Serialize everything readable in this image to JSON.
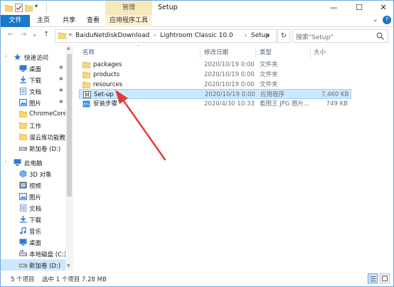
{
  "window": {
    "title": "Setup",
    "contextual_tab_group": "管理",
    "controls": {
      "minimize": "—",
      "maximize": "☐",
      "close": "✕"
    }
  },
  "ribbon": {
    "tabs": [
      "文件",
      "主页",
      "共享",
      "查看",
      "应用程序工具"
    ],
    "collapse": "⌄",
    "help": "?"
  },
  "address": {
    "prefix": "«",
    "crumbs": [
      "BaiduNetdiskDownload",
      "Lightroom Classic 10.0",
      "Setup"
    ],
    "separator": "›",
    "refresh": "↻",
    "search_placeholder": "搜索\"Setup\""
  },
  "navigation": {
    "quick_access": "快速访问",
    "items": [
      {
        "label": "桌面",
        "icon": "desktop-icon",
        "pinned": true
      },
      {
        "label": "下载",
        "icon": "download-icon",
        "pinned": true
      },
      {
        "label": "文档",
        "icon": "document-icon",
        "pinned": true
      },
      {
        "label": "图片",
        "icon": "picture-icon",
        "pinned": true
      },
      {
        "label": "ChromeCoreD",
        "icon": "folder-icon",
        "pinned": false
      },
      {
        "label": "工作",
        "icon": "folder-icon",
        "pinned": false
      },
      {
        "label": "溜云库功能教程",
        "icon": "folder-icon",
        "pinned": false
      },
      {
        "label": "新加卷 (D:)",
        "icon": "drive-icon",
        "pinned": false
      }
    ],
    "this_pc": "此电脑",
    "pc_items": [
      {
        "label": "3D 对象",
        "icon": "cube-icon"
      },
      {
        "label": "视频",
        "icon": "video-icon"
      },
      {
        "label": "图片",
        "icon": "picture-icon"
      },
      {
        "label": "文档",
        "icon": "document-icon"
      },
      {
        "label": "下载",
        "icon": "download-icon"
      },
      {
        "label": "音乐",
        "icon": "music-icon"
      },
      {
        "label": "桌面",
        "icon": "desktop-icon"
      },
      {
        "label": "本地磁盘 (C:)",
        "icon": "drive-icon"
      },
      {
        "label": "新加卷 (D:)",
        "icon": "drive-icon"
      }
    ],
    "pin_glyph": "✱",
    "expand_glyph": "›"
  },
  "file_list": {
    "columns": {
      "name": "名称",
      "date": "修改日期",
      "type": "类型",
      "size": "大小"
    },
    "sort_glyph": "⌃",
    "rows": [
      {
        "name": "packages",
        "date": "2020/10/19 0:00",
        "type": "文件夹",
        "size": "",
        "icon": "folder-icon",
        "selected": false
      },
      {
        "name": "products",
        "date": "2020/10/19 0:00",
        "type": "文件夹",
        "size": "",
        "icon": "folder-icon",
        "selected": false
      },
      {
        "name": "resources",
        "date": "2020/10/19 0:00",
        "type": "文件夹",
        "size": "",
        "icon": "folder-icon",
        "selected": false
      },
      {
        "name": "Set-up",
        "date": "2020/10/19 0:00",
        "type": "应用程序",
        "size": "7,460 KB",
        "icon": "setup-app-icon",
        "selected": true
      },
      {
        "name": "安装步骤",
        "date": "2020/4/30 10:33",
        "type": "看图王 JPG 图片...",
        "size": "749 KB",
        "icon": "jpg-image-icon",
        "selected": false
      }
    ]
  },
  "status_bar": {
    "item_count": "5 个项目",
    "selection": "选中 1 个项目  7.28 MB"
  },
  "colors": {
    "accent": "#1979ca",
    "selection": "#cce8ff",
    "folder": "#f8d775",
    "annotation_arrow": "#e53935"
  }
}
